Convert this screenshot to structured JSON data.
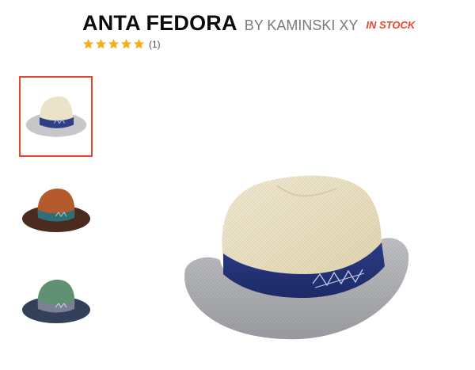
{
  "product": {
    "title": "ANTA FEDORA",
    "brand": "BY KAMINSKI XY",
    "stock_status": "IN STOCK",
    "rating": 5,
    "rating_max": 5,
    "review_count": "(1)"
  },
  "colors": {
    "accent": "#e8452c",
    "star": "#f5b01c",
    "brand_text": "#7a7a7a"
  },
  "thumbnails": [
    {
      "name": "natural-navy",
      "selected": true
    },
    {
      "name": "rust-teal",
      "selected": false
    },
    {
      "name": "green-navy",
      "selected": false
    }
  ]
}
